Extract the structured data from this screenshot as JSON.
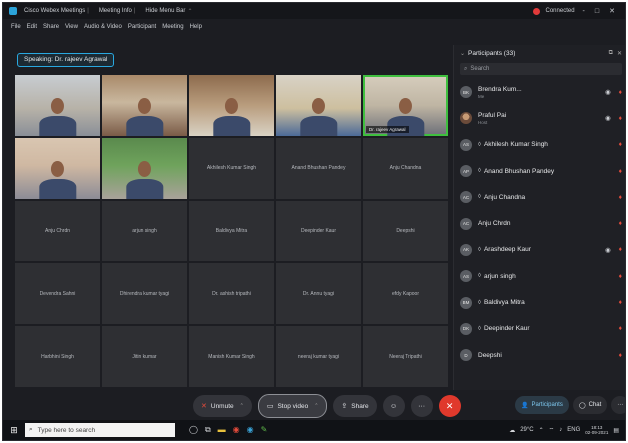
{
  "titlebar": {
    "tabs": [
      "Cisco Webex Meetings",
      "Meeting Info",
      "Hide Menu Bar"
    ],
    "connected_label": "Connected",
    "window_controls": [
      "-",
      "□",
      "✕"
    ]
  },
  "menubar": {
    "items": [
      "File",
      "Edit",
      "Share",
      "View",
      "Audio & Video",
      "Participant",
      "Meeting",
      "Help"
    ]
  },
  "speaking_label": "Speaking: Dr. rajeev Agrawal",
  "video_tiles": [
    {
      "name": "",
      "video": true,
      "bg": "bg1"
    },
    {
      "name": "",
      "video": true,
      "bg": "bg2"
    },
    {
      "name": "",
      "video": true,
      "bg": "bg3"
    },
    {
      "name": "",
      "video": true,
      "bg": "bg4"
    },
    {
      "name": "Dr. rajeev Agrawal",
      "video": true,
      "bg": "bg5",
      "active": true
    },
    {
      "name": "",
      "video": true,
      "bg": "bg6"
    },
    {
      "name": "",
      "video": true,
      "bg": "bg7"
    },
    {
      "name": "Akhilesh Kumar Singh",
      "video": false
    },
    {
      "name": "Anand Bhushan Pandey",
      "video": false
    },
    {
      "name": "Anju Chandna",
      "video": false
    },
    {
      "name": "Anju Chrdn",
      "video": false
    },
    {
      "name": "arjun singh",
      "video": false
    },
    {
      "name": "Baldivya Mitra",
      "video": false
    },
    {
      "name": "Deepinder Kaur",
      "video": false
    },
    {
      "name": "Deepshi",
      "video": false
    },
    {
      "name": "Devendra Sahni",
      "video": false
    },
    {
      "name": "Dhirendra kumar tyagi",
      "video": false
    },
    {
      "name": "Dr. ashish tripathi",
      "video": false
    },
    {
      "name": "Dr. Annu tyagi",
      "video": false
    },
    {
      "name": "efdy Kapoor",
      "video": false
    },
    {
      "name": "Harbhini Singh",
      "video": false
    },
    {
      "name": "Jitin kumar",
      "video": false
    },
    {
      "name": "Manish Kumar Singh",
      "video": false
    },
    {
      "name": "neeraj kumar tyagi",
      "video": false
    },
    {
      "name": "Neeraj Tripathi",
      "video": false
    }
  ],
  "participants_panel": {
    "title": "Participants (33)",
    "search_placeholder": "Search",
    "participants": [
      {
        "name": "Brendra Kum...",
        "role": "Me",
        "initials": "BK",
        "hand": false,
        "cam": true,
        "photo": false
      },
      {
        "name": "Praful Pai",
        "role": "Host",
        "initials": "PP",
        "hand": false,
        "cam": true,
        "photo": true
      },
      {
        "name": "Akhilesh Kumar Singh",
        "role": "",
        "initials": "AS",
        "hand": true,
        "cam": false,
        "photo": false
      },
      {
        "name": "Anand Bhushan Pandey",
        "role": "",
        "initials": "AP",
        "hand": true,
        "cam": false,
        "photo": false
      },
      {
        "name": "Anju Chandna",
        "role": "",
        "initials": "AC",
        "hand": true,
        "cam": false,
        "photo": false
      },
      {
        "name": "Anju Chrdn",
        "role": "",
        "initials": "AC",
        "hand": false,
        "cam": false,
        "photo": false
      },
      {
        "name": "Arashdeep Kaur",
        "role": "",
        "initials": "AK",
        "hand": true,
        "cam": true,
        "photo": false
      },
      {
        "name": "arjun singh",
        "role": "",
        "initials": "AS",
        "hand": true,
        "cam": false,
        "photo": false
      },
      {
        "name": "Baldivya Mitra",
        "role": "",
        "initials": "BM",
        "hand": true,
        "cam": false,
        "photo": false
      },
      {
        "name": "Deepinder Kaur",
        "role": "",
        "initials": "DK",
        "hand": true,
        "cam": false,
        "photo": false
      },
      {
        "name": "Deepshi",
        "role": "",
        "initials": "D",
        "hand": false,
        "cam": false,
        "photo": false
      }
    ]
  },
  "controls": {
    "unmute_label": "Unmute",
    "stop_video_label": "Stop video",
    "share_label": "Share",
    "more_label": "···"
  },
  "panel_tabs": {
    "participants_label": "Participants",
    "chat_label": "Chat"
  },
  "taskbar": {
    "search_placeholder": "Type here to search",
    "temperature": "29°C",
    "language": "ENG",
    "time": "18:13",
    "date": "02-09-2021"
  }
}
